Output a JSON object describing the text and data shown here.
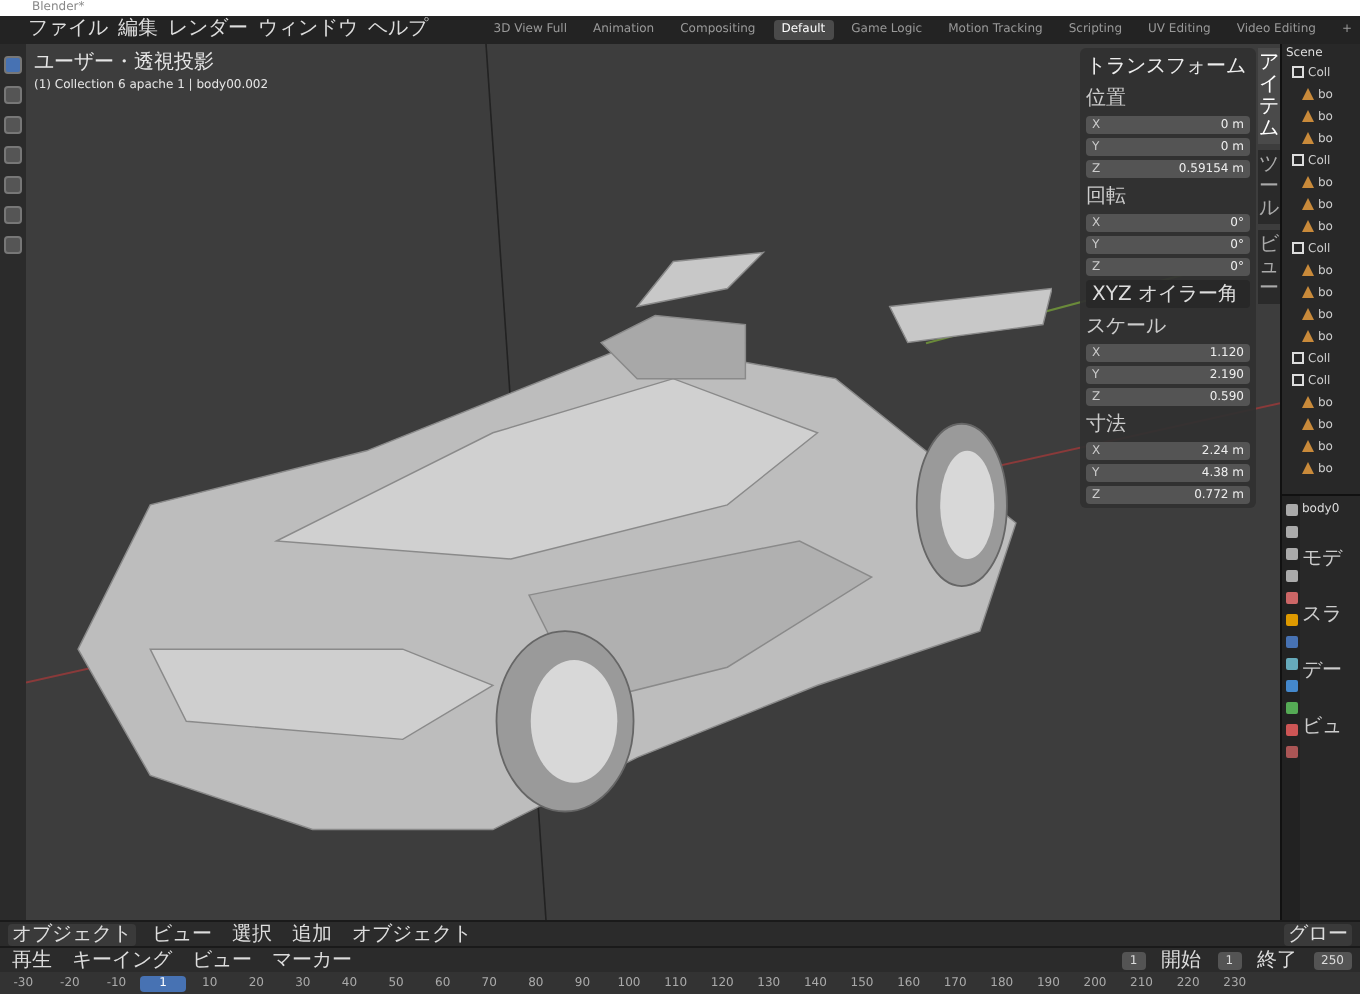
{
  "window": {
    "title": "Blender*"
  },
  "menus": [
    "ファイル",
    "編集",
    "レンダー",
    "ウィンドウ",
    "ヘルプ"
  ],
  "workspaces": [
    {
      "label": "3D View Full",
      "selected": false
    },
    {
      "label": "Animation",
      "selected": false
    },
    {
      "label": "Compositing",
      "selected": false
    },
    {
      "label": "Default",
      "selected": true
    },
    {
      "label": "Game Logic",
      "selected": false
    },
    {
      "label": "Motion Tracking",
      "selected": false
    },
    {
      "label": "Scripting",
      "selected": false
    },
    {
      "label": "UV Editing",
      "selected": false
    },
    {
      "label": "Video Editing",
      "selected": false
    },
    {
      "label": "+",
      "selected": false
    }
  ],
  "viewport": {
    "view_label": "ユーザー・透視投影",
    "object_label": "(1) Collection 6 apache 1 | body00.002"
  },
  "transform": {
    "title": "トランスフォーム",
    "groups": [
      {
        "label": "位置",
        "rows": [
          {
            "axis": "X",
            "value": "0 m"
          },
          {
            "axis": "Y",
            "value": "0 m"
          },
          {
            "axis": "Z",
            "value": "0.59154 m"
          }
        ]
      },
      {
        "label": "回転",
        "rows": [
          {
            "axis": "X",
            "value": "0°"
          },
          {
            "axis": "Y",
            "value": "0°"
          },
          {
            "axis": "Z",
            "value": "0°"
          }
        ],
        "mode": "XYZ オイラー角"
      },
      {
        "label": "スケール",
        "rows": [
          {
            "axis": "X",
            "value": "1.120"
          },
          {
            "axis": "Y",
            "value": "2.190"
          },
          {
            "axis": "Z",
            "value": "0.590"
          }
        ]
      },
      {
        "label": "寸法",
        "rows": [
          {
            "axis": "X",
            "value": "2.24 m"
          },
          {
            "axis": "Y",
            "value": "4.38 m"
          },
          {
            "axis": "Z",
            "value": "0.772 m"
          }
        ]
      }
    ]
  },
  "side_tabs": [
    {
      "label": "アイテム",
      "selected": true
    },
    {
      "label": "ツール",
      "selected": false
    },
    {
      "label": "ビュー",
      "selected": false
    }
  ],
  "outliner": {
    "title": "Scene",
    "rows": [
      {
        "kind": "collection",
        "label": "Coll"
      },
      {
        "kind": "object",
        "label": "bo"
      },
      {
        "kind": "object",
        "label": "bo"
      },
      {
        "kind": "object",
        "label": "bo"
      },
      {
        "kind": "collection",
        "label": "Coll"
      },
      {
        "kind": "object",
        "label": "bo"
      },
      {
        "kind": "object",
        "label": "bo"
      },
      {
        "kind": "object",
        "label": "bo"
      },
      {
        "kind": "collection",
        "label": "Coll"
      },
      {
        "kind": "object",
        "label": "bo"
      },
      {
        "kind": "object",
        "label": "bo"
      },
      {
        "kind": "object",
        "label": "bo"
      },
      {
        "kind": "object",
        "label": "bo"
      },
      {
        "kind": "collection",
        "label": "Coll"
      },
      {
        "kind": "collection",
        "label": "Coll"
      },
      {
        "kind": "object",
        "label": "bo"
      },
      {
        "kind": "object",
        "label": "bo"
      },
      {
        "kind": "object",
        "label": "bo"
      },
      {
        "kind": "object",
        "label": "bo"
      }
    ]
  },
  "properties": {
    "object_name": "body0",
    "sections": [
      "モデ",
      "スラ",
      "デー",
      "ビュ"
    ]
  },
  "viewport_header": {
    "mode": "オブジェクト",
    "menus": [
      "ビュー",
      "選択",
      "追加",
      "オブジェクト"
    ],
    "orientation": "グロー"
  },
  "timeline": {
    "menus": [
      "再生",
      "キーイング",
      "ビュー",
      "マーカー"
    ],
    "ticks": [
      {
        "label": "-30",
        "selected": false
      },
      {
        "label": "-20",
        "selected": false
      },
      {
        "label": "-10",
        "selected": false
      },
      {
        "label": "1",
        "selected": true
      },
      {
        "label": "10",
        "selected": false
      },
      {
        "label": "20",
        "selected": false
      },
      {
        "label": "30",
        "selected": false
      },
      {
        "label": "40",
        "selected": false
      },
      {
        "label": "50",
        "selected": false
      },
      {
        "label": "60",
        "selected": false
      },
      {
        "label": "70",
        "selected": false
      },
      {
        "label": "80",
        "selected": false
      },
      {
        "label": "90",
        "selected": false
      },
      {
        "label": "100",
        "selected": false
      },
      {
        "label": "110",
        "selected": false
      },
      {
        "label": "120",
        "selected": false
      },
      {
        "label": "130",
        "selected": false
      },
      {
        "label": "140",
        "selected": false
      },
      {
        "label": "150",
        "selected": false
      },
      {
        "label": "160",
        "selected": false
      },
      {
        "label": "170",
        "selected": false
      },
      {
        "label": "180",
        "selected": false
      },
      {
        "label": "190",
        "selected": false
      },
      {
        "label": "200",
        "selected": false
      },
      {
        "label": "210",
        "selected": false
      },
      {
        "label": "220",
        "selected": false
      },
      {
        "label": "230",
        "selected": false
      }
    ],
    "current_frame": "1",
    "start_label": "開始",
    "start": "1",
    "end_label": "終了",
    "end": "250"
  }
}
